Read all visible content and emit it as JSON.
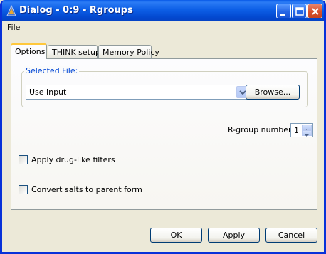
{
  "window": {
    "title": "Dialog - 0:9 - Rgroups"
  },
  "menu": {
    "items": [
      {
        "label": "File"
      }
    ]
  },
  "tabs": [
    {
      "label": "Options",
      "active": true
    },
    {
      "label": "THINK setup",
      "active": false
    },
    {
      "label": "Memory Policy",
      "active": false
    }
  ],
  "options": {
    "selected_file_legend": "Selected File:",
    "file_select": {
      "value": "Use input"
    },
    "browse_label": "Browse...",
    "rgroup_label": "R-group number:",
    "rgroup_value": "1",
    "checkboxes": [
      {
        "label": "Apply drug-like filters",
        "checked": false
      },
      {
        "label": "Convert salts to parent form",
        "checked": false
      }
    ]
  },
  "footer": {
    "ok_label": "OK",
    "apply_label": "Apply",
    "cancel_label": "Cancel"
  },
  "colors": {
    "titlebar": "#0a5be8",
    "accent": "#0046d5",
    "tab_highlight": "#ffc83c",
    "window_bg": "#ece9d8"
  }
}
